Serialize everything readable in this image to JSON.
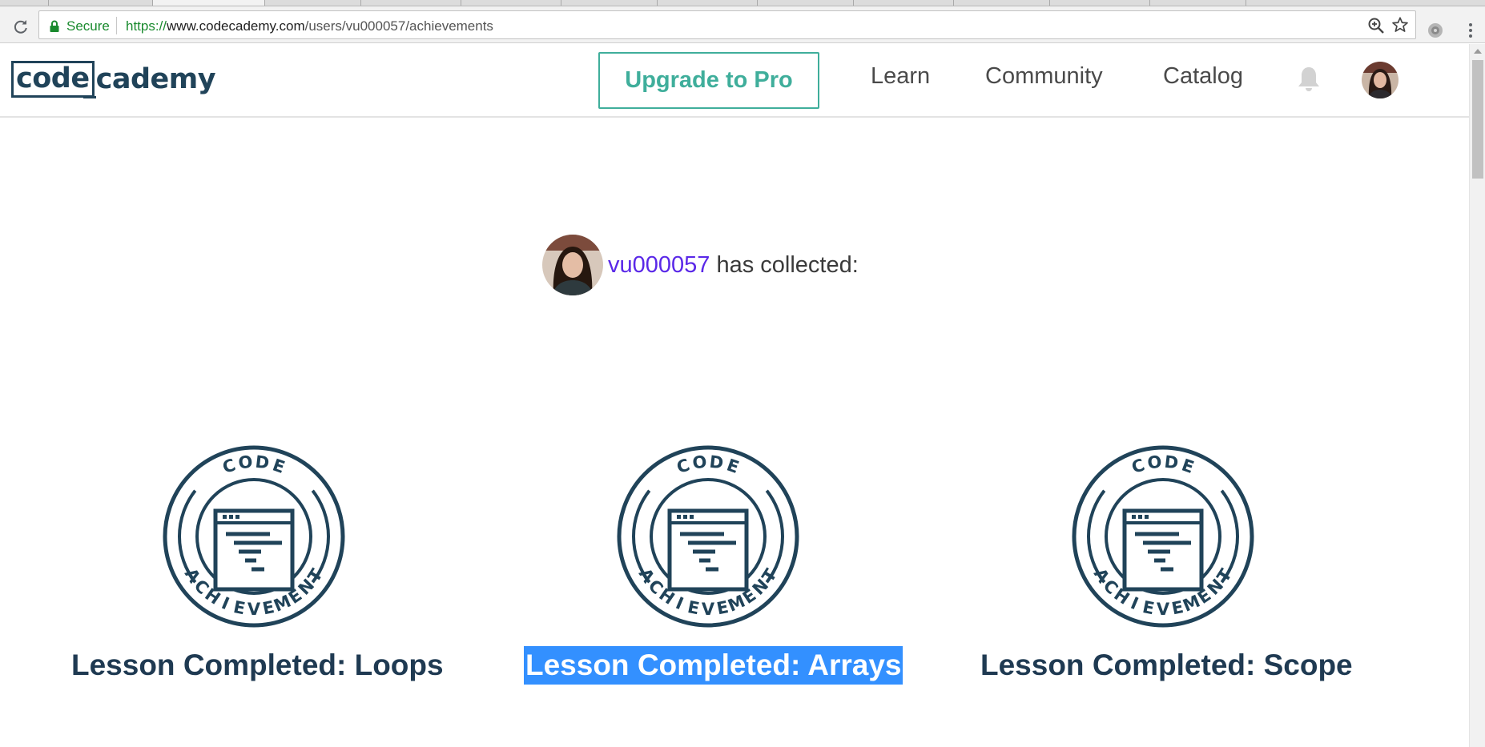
{
  "browser": {
    "secure_label": "Secure",
    "url_scheme": "https://",
    "url_host": "www.codecademy.com",
    "url_path": "/users/vu000057/achievements"
  },
  "header": {
    "logo_boxed": "code",
    "logo_rest": "cademy",
    "upgrade_label": "Upgrade to Pro",
    "nav": {
      "learn": "Learn",
      "community": "Community",
      "catalog": "Catalog"
    }
  },
  "profile": {
    "username": "vu000057",
    "collected_text": " has collected:"
  },
  "badge_text": {
    "top": "CODE",
    "bottom": "ACHIEVEMENT"
  },
  "achievements": [
    {
      "title": "Lesson Completed: Loops",
      "selected": false
    },
    {
      "title": "Lesson Completed: Arrays",
      "selected": true
    },
    {
      "title": "Lesson Completed: Scope",
      "selected": false
    }
  ],
  "colors": {
    "brand_navy": "#204359",
    "accent_teal": "#3fae9b",
    "link_purple": "#5a28e8",
    "selection_blue": "#3390ff"
  },
  "icons": [
    "reload-icon",
    "lock-icon",
    "zoom-icon",
    "star-icon",
    "extension-icon",
    "menu-icon",
    "bell-icon"
  ]
}
